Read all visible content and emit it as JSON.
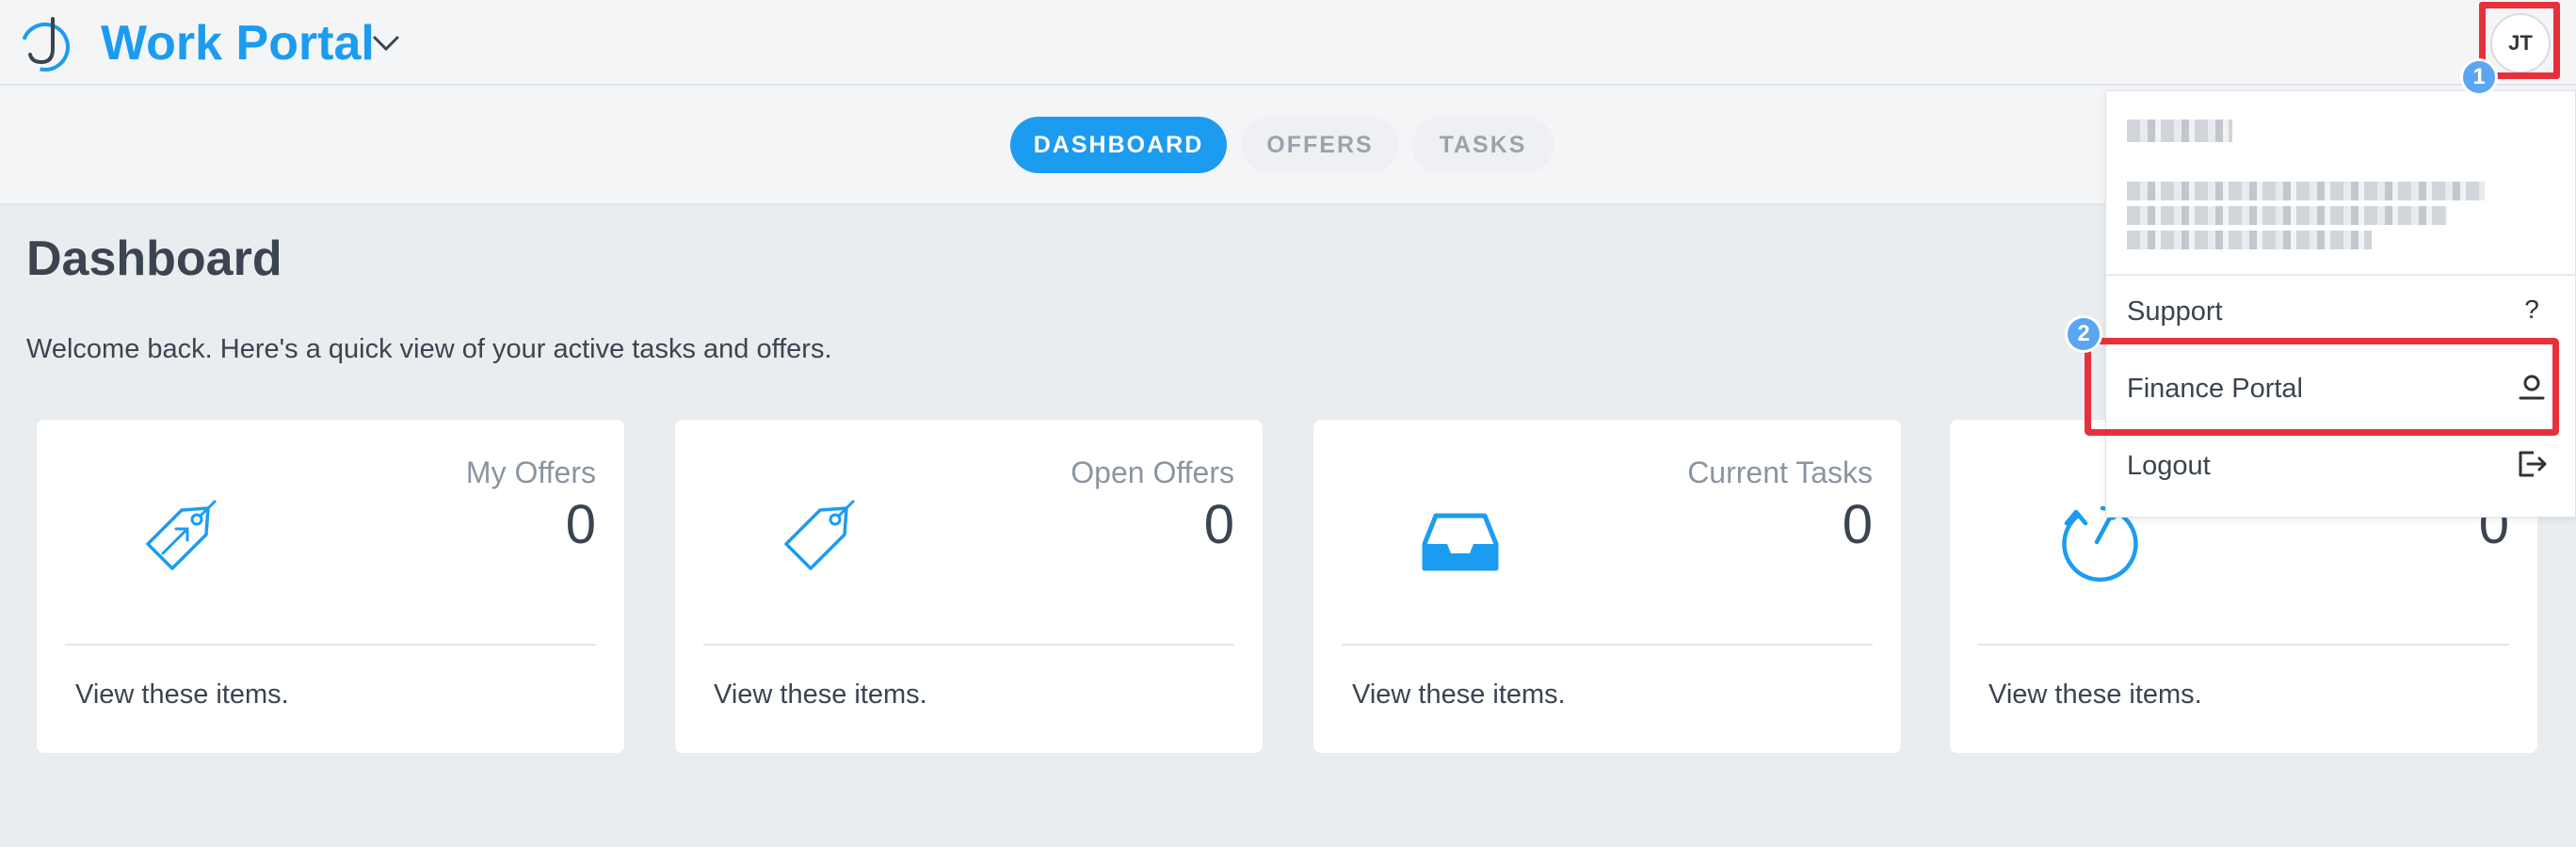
{
  "header": {
    "app_title": "Work Portal",
    "logo_icon": "portal-logo-icon",
    "title_dropdown_icon": "chevron-down-icon",
    "avatar_initials": "JT"
  },
  "tabs": [
    {
      "label": "DASHBOARD",
      "active": true
    },
    {
      "label": "OFFERS",
      "active": false
    },
    {
      "label": "TASKS",
      "active": false
    }
  ],
  "page": {
    "heading": "Dashboard",
    "welcome": "Welcome back. Here's a quick view of your active tasks and offers."
  },
  "cards": [
    {
      "label": "My Offers",
      "count": "0",
      "link": "View these items.",
      "icon": "tag-arrow-icon"
    },
    {
      "label": "Open Offers",
      "count": "0",
      "link": "View these items.",
      "icon": "tag-icon"
    },
    {
      "label": "Current Tasks",
      "count": "0",
      "link": "View these items.",
      "icon": "inbox-tray-icon"
    },
    {
      "label": "",
      "count": "0",
      "link": "View these items.",
      "icon": "refresh-clock-icon"
    }
  ],
  "user_menu": {
    "items": [
      {
        "label": "Support",
        "icon": "question-icon",
        "glyph": "?"
      },
      {
        "label": "Finance Portal",
        "icon": "user-icon"
      },
      {
        "label": "Logout",
        "icon": "logout-icon"
      }
    ]
  },
  "annotations": {
    "badge_1": "1",
    "badge_2": "2",
    "highlight_color": "#e8303c"
  },
  "colors": {
    "accent": "#1c9cf0",
    "page_bg": "#e9edf0",
    "text": "#3b4450",
    "muted": "#8a95a1"
  }
}
